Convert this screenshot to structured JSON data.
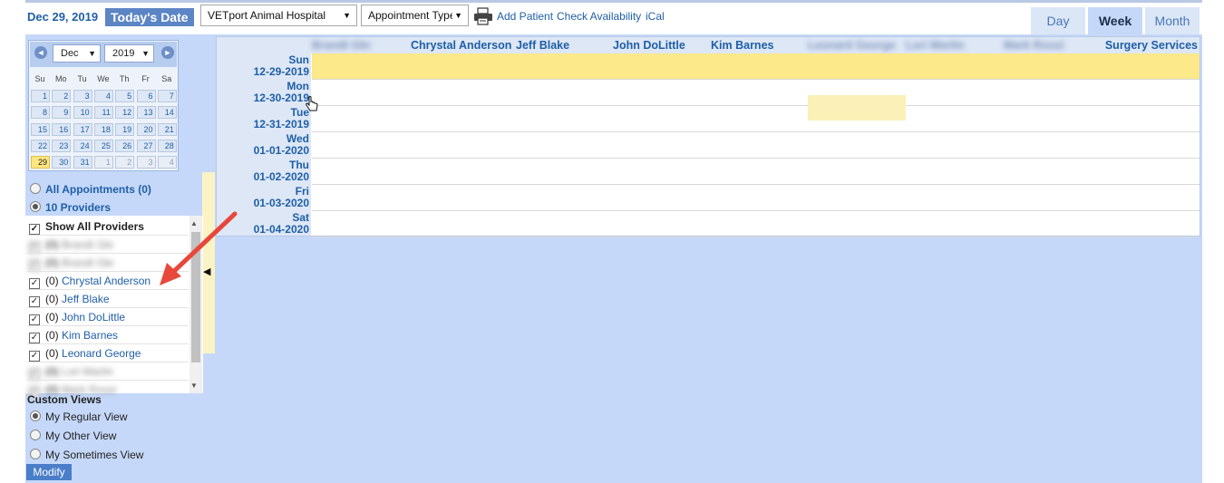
{
  "toolbar": {
    "current_date": "Dec 29, 2019",
    "today_label": "Today's Date",
    "hospital": "VETport Animal Hospital",
    "appointment_type": "Appointment Type",
    "links": {
      "add_patient": "Add Patient",
      "check_availability": "Check Availability",
      "ical": "iCal"
    },
    "views": {
      "day": "Day",
      "week": "Week",
      "month": "Month"
    },
    "active_view": "Week"
  },
  "minical": {
    "month": "Dec",
    "year": "2019",
    "prev": "◄",
    "next": "►",
    "dows": [
      "Su",
      "Mo",
      "Tu",
      "We",
      "Th",
      "Fr",
      "Sa"
    ],
    "weeks": [
      [
        "1",
        "2",
        "3",
        "4",
        "5",
        "6",
        "7"
      ],
      [
        "8",
        "9",
        "10",
        "11",
        "12",
        "13",
        "14"
      ],
      [
        "15",
        "16",
        "17",
        "18",
        "19",
        "20",
        "21"
      ],
      [
        "22",
        "23",
        "24",
        "25",
        "26",
        "27",
        "28"
      ],
      [
        "29",
        "30",
        "31",
        "1",
        "2",
        "3",
        "4"
      ]
    ],
    "today": "29"
  },
  "filter": {
    "all_appointments": "All Appointments (0)",
    "providers_count": "10 Providers",
    "show_all": "Show All Providers",
    "providers": [
      {
        "count": "(0)",
        "name": "Brandt Gkr",
        "blurred": true
      },
      {
        "count": "(0)",
        "name": "Brandt Gkr",
        "blurred": true
      },
      {
        "count": "(0)",
        "name": "Chrystal Anderson",
        "blurred": false
      },
      {
        "count": "(0)",
        "name": "Jeff Blake",
        "blurred": false
      },
      {
        "count": "(0)",
        "name": "John DoLittle",
        "blurred": false
      },
      {
        "count": "(0)",
        "name": "Kim Barnes",
        "blurred": false
      },
      {
        "count": "(0)",
        "name": "Leonard George",
        "blurred": false
      },
      {
        "count": "(0)",
        "name": "Lori Martin",
        "blurred": true
      },
      {
        "count": "(0)",
        "name": "Mark Rossi",
        "blurred": true
      }
    ]
  },
  "custom_views": {
    "title": "Custom Views",
    "options": [
      "My Regular View",
      "My Other View",
      "My Sometimes View"
    ],
    "selected": "My Regular View",
    "modify": "Modify"
  },
  "schedule": {
    "providers": [
      {
        "name": "Brandt Gkr",
        "blurred": true
      },
      {
        "name": "Chrystal Anderson",
        "blurred": false
      },
      {
        "name": "Jeff Blake",
        "blurred": false
      },
      {
        "name": "John DoLittle",
        "blurred": false
      },
      {
        "name": "Kim Barnes",
        "blurred": false
      },
      {
        "name": "Leonard George",
        "blurred": true
      },
      {
        "name": "Lori Martin",
        "blurred": true
      },
      {
        "name": "Mark Rossi",
        "blurred": true
      },
      {
        "name": "Surgery Services",
        "blurred": false
      }
    ],
    "days": [
      {
        "name": "Sun",
        "date": "12-29-2019"
      },
      {
        "name": "Mon",
        "date": "12-30-2019"
      },
      {
        "name": "Tue",
        "date": "12-31-2019"
      },
      {
        "name": "Wed",
        "date": "01-01-2020"
      },
      {
        "name": "Thu",
        "date": "01-02-2020"
      },
      {
        "name": "Fri",
        "date": "01-03-2020"
      },
      {
        "name": "Sat",
        "date": "01-04-2020"
      }
    ]
  },
  "colors": {
    "accent": "#1f5fa7",
    "today": "#fbe98a",
    "panel": "#c5d8f9",
    "annotation": "#e8473b"
  }
}
